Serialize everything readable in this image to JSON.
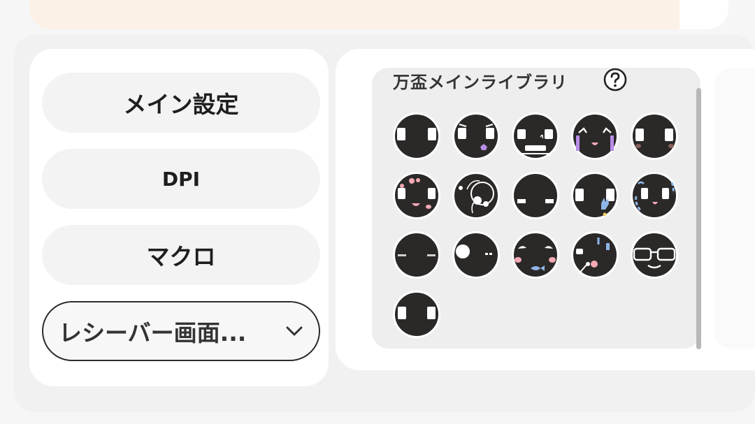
{
  "menu": {
    "items": [
      {
        "label": "メイン設定"
      },
      {
        "label": "DPI"
      },
      {
        "label": "マクロ"
      },
      {
        "label": "レシーバー画面..."
      }
    ]
  },
  "library": {
    "title": "万盃メインライブラリ",
    "help_icon": "question-circle-icon",
    "faces": [
      "face-square-eyes",
      "face-angry-eyes",
      "face-tired",
      "face-purple-tears",
      "face-blush-square",
      "face-flower-blush",
      "face-sketch-cat",
      "face-dash-eyes",
      "face-bunny-charm",
      "face-blue-drops",
      "face-line-eyes",
      "face-wink-dots",
      "face-fish-blush",
      "face-music-note",
      "face-sunglasses",
      "face-square-eyes-2"
    ]
  },
  "colors": {
    "face_fill": "#2b2928",
    "accent_pink": "#f3a9b4",
    "accent_purple": "#b98de8",
    "accent_blue": "#8fb6e8"
  }
}
